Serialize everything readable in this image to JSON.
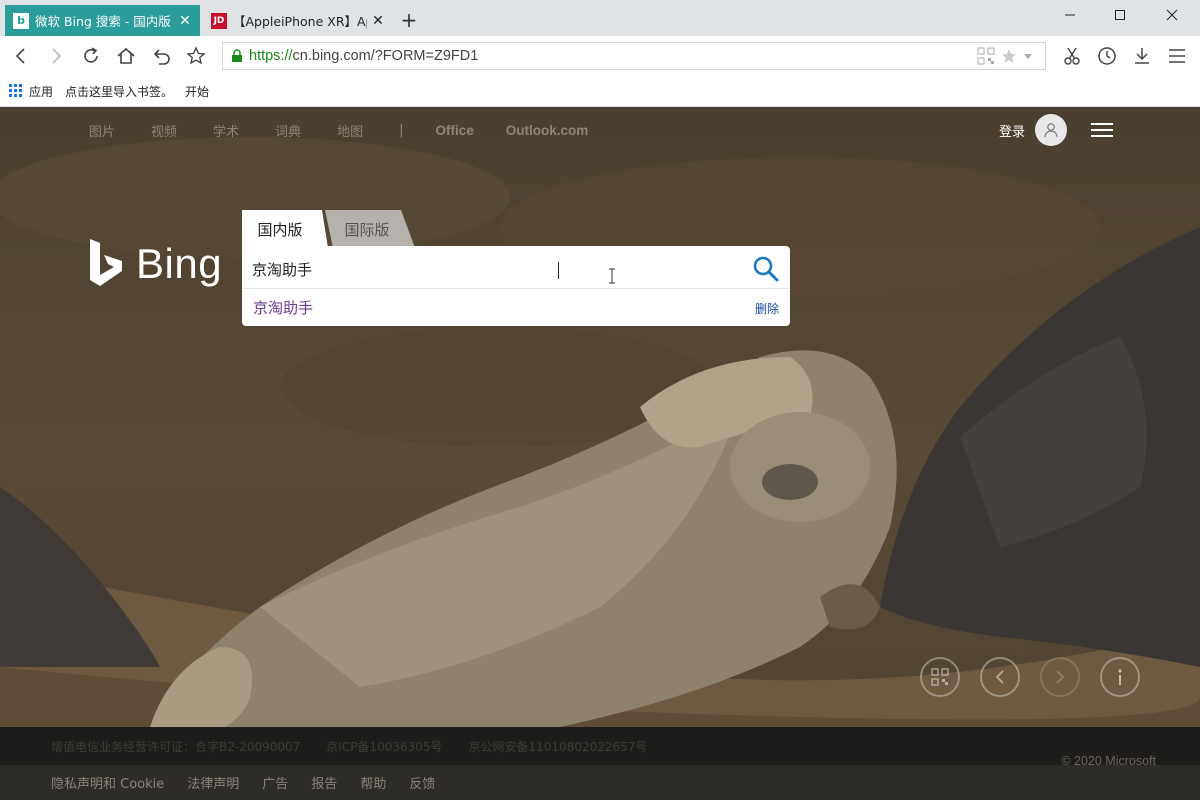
{
  "browser": {
    "tabs": [
      {
        "title": "微软 Bing 搜索 - 国内版",
        "favicon": "bing-favicon-icon",
        "active": true
      },
      {
        "title": "【AppleiPhone XR】Apple",
        "favicon": "jd-favicon-icon",
        "favicon_text": "JD",
        "active": false
      }
    ],
    "new_tab": "+",
    "url_scheme": "https://",
    "url_rest": "cn.bing.com/?FORM=Z9FD1",
    "bookmarks": [
      {
        "label": "应用",
        "icon": "apps-grid-icon"
      },
      {
        "label": "点击这里导入书签。"
      },
      {
        "label": "开始"
      }
    ]
  },
  "page": {
    "nav_links": [
      "图片",
      "视频",
      "学术",
      "词典",
      "地图"
    ],
    "nav_sep": "|",
    "nav_links_2": [
      "Office",
      "Outlook.com"
    ],
    "login": "登录",
    "logo": "Bing",
    "scopes": {
      "domestic": "国内版",
      "international": "国际版"
    },
    "search": {
      "value": "京淘助手"
    },
    "suggestion": {
      "text": "京淘助手",
      "delete": "删除"
    },
    "footer_licenses": [
      "增值电信业务经营许可证：合字B2-20090007",
      "京ICP备10036305号",
      "京公网安备11010802022657号"
    ],
    "footer_links": [
      "隐私声明和 Cookie",
      "法律声明",
      "广告",
      "报告",
      "帮助",
      "反馈"
    ],
    "copyright": "© 2020 Microsoft"
  },
  "colors": {
    "tab_active": "#2a9c9a",
    "url_https": "#1b8a1b",
    "suggestion": "#6a3a93",
    "search_icon": "#1b78c4"
  }
}
